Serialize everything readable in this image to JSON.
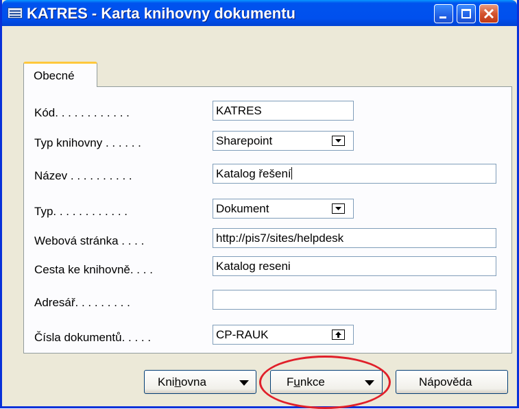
{
  "window": {
    "title": "KATRES - Karta knihovny dokumentu"
  },
  "tabs": [
    {
      "label": "Obecné"
    }
  ],
  "fields": {
    "kod": {
      "label": "Kód. . . . . . . . . . . .",
      "value": "KATRES"
    },
    "typ_knihovny": {
      "label": "Typ knihovny . . . . . .",
      "value": "Sharepoint"
    },
    "nazev": {
      "label": "Název . . . . . . . . . .",
      "value": "Katalog řešení"
    },
    "typ": {
      "label": "Typ. . . . . . . . . . . .",
      "value": "Dokument"
    },
    "webova_stranka": {
      "label": "Webová stránka . . . .",
      "value": "http://pis7/sites/helpdesk"
    },
    "cesta": {
      "label": "Cesta ke knihovně. . . .",
      "value": "Katalog reseni"
    },
    "adresar": {
      "label": "Adresář. . . . . . . . .",
      "value": ""
    },
    "cisla_dokumentu": {
      "label": "Čísla dokumentů. . . . .",
      "value": "CP-RAUK"
    }
  },
  "buttons": {
    "knihovna": {
      "label_pre": "Kni",
      "label_mnemonic": "h",
      "label_post": "ovna"
    },
    "funkce": {
      "label_pre": "F",
      "label_mnemonic": "u",
      "label_post": "nkce"
    },
    "napoveda": {
      "label": "Nápověda"
    }
  },
  "colors": {
    "title_bar": "#0054e3",
    "highlight_ellipse": "#e0202a",
    "tab_accent": "#ffc83c"
  }
}
